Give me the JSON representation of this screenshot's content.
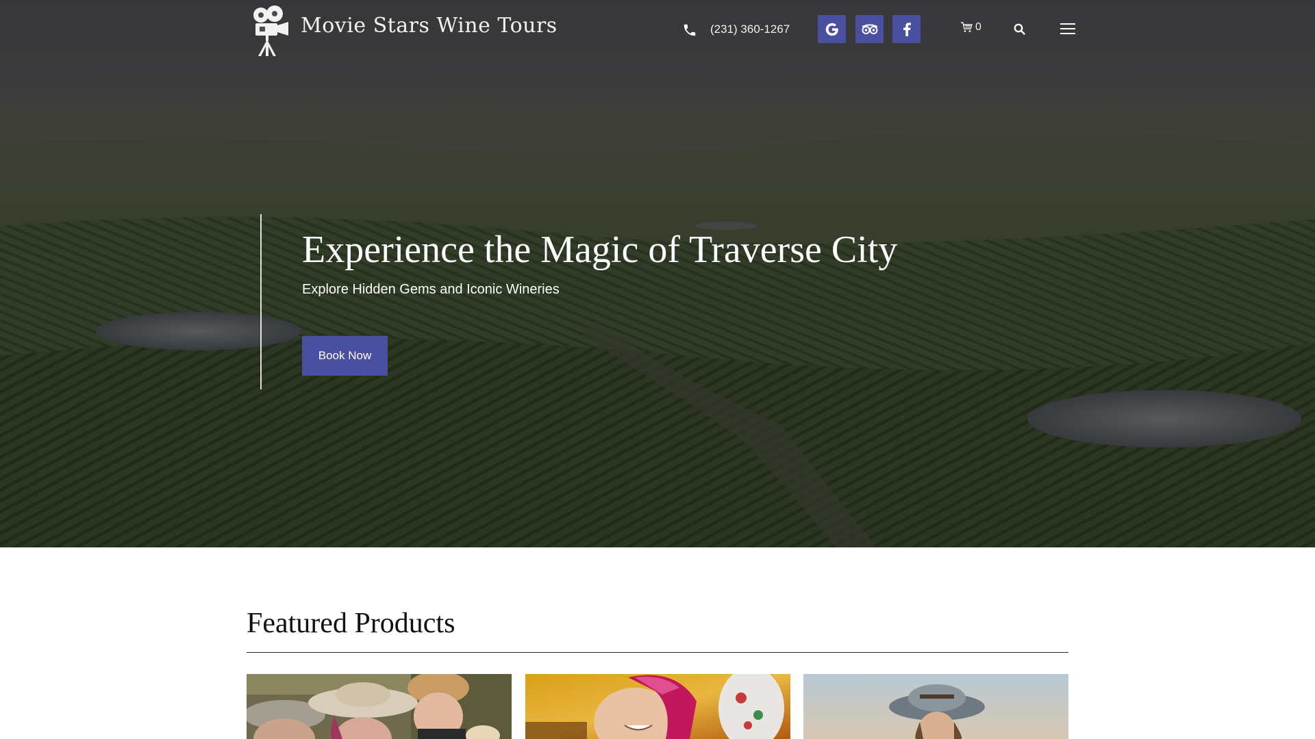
{
  "header": {
    "brand_name": "Movie Stars Wine Tours",
    "phone": "(231) 360-1267",
    "social": [
      {
        "name": "google",
        "icon": "google-icon"
      },
      {
        "name": "tripadvisor",
        "icon": "tripadvisor-icon"
      },
      {
        "name": "facebook",
        "icon": "facebook-icon"
      }
    ],
    "cart_count": "0",
    "accent_color": "#4a4fa0"
  },
  "hero": {
    "title": "Experience the Magic of Traverse City",
    "subtitle": "Explore Hidden Gems and Iconic Wineries",
    "cta_label": "Book Now"
  },
  "featured": {
    "title": "Featured Products",
    "products": [
      {
        "image": "group-of-women-in-hats-photo"
      },
      {
        "image": "woman-in-pink-headscarf-sunset-photo"
      },
      {
        "image": "woman-in-cowboy-hat-photo"
      }
    ]
  }
}
